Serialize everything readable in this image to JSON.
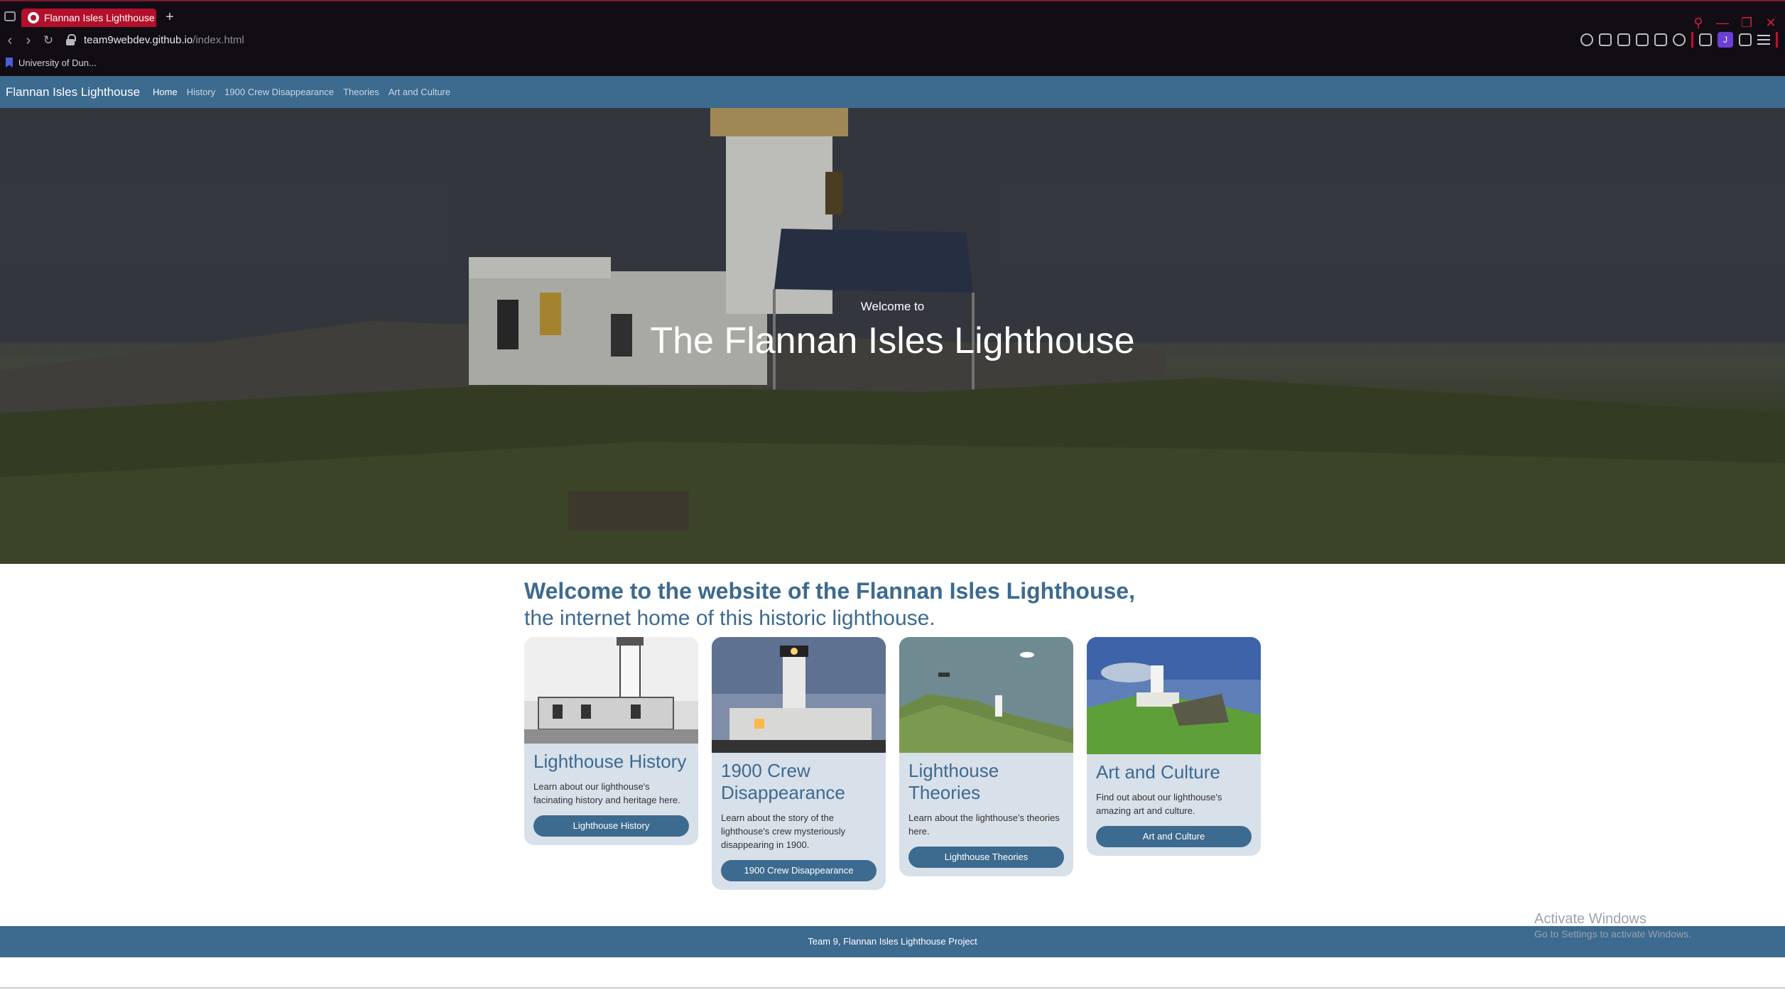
{
  "browser": {
    "tab_title": "Flannan Isles Lighthouse",
    "new_tab_symbol": "+",
    "url_domain": "team9webdev.github.io",
    "url_path": "/index.html",
    "bookmark_label": "University of Dun...",
    "profile_initial": "J",
    "accent_color": "#b3102b"
  },
  "nav": {
    "brand": "Flannan Isles Lighthouse",
    "links": [
      "Home",
      "History",
      "1900 Crew Disappearance",
      "Theories",
      "Art and Culture"
    ],
    "active": "Home",
    "background": "#3d6a8f"
  },
  "hero": {
    "subtitle": "Welcome to",
    "title": "The Flannan Isles Lighthouse"
  },
  "intro": {
    "heading": "Welcome to the website of the Flannan Isles Lighthouse,",
    "subheading": "the internet home of this historic lighthouse."
  },
  "cards": [
    {
      "title": "Lighthouse History",
      "text": "Learn about our lighthouse's facinating history and heritage here.",
      "button": "Lighthouse History",
      "image": "black-and-white lighthouse photo"
    },
    {
      "title": "1900 Crew Disappearance",
      "text": "Learn about the story of the lighthouse's crew mysteriously disappearing in 1900.",
      "button": "1900 Crew Disappearance",
      "image": "lighthouse at dusk photo"
    },
    {
      "title": "Lighthouse Theories",
      "text": "Learn about the lighthouse's theories here.",
      "button": "Lighthouse Theories",
      "image": "aerial island lighthouse photo"
    },
    {
      "title": "Art and Culture",
      "text": "Find out about our lighthouse's amazing art and culture.",
      "button": "Art and Culture",
      "image": "painted lighthouse on green hill"
    }
  ],
  "footer": {
    "text": "Team 9, Flannan Isles Lighthouse Project"
  },
  "os_watermark": {
    "line1": "Activate Windows",
    "line2": "Go to Settings to activate Windows."
  }
}
